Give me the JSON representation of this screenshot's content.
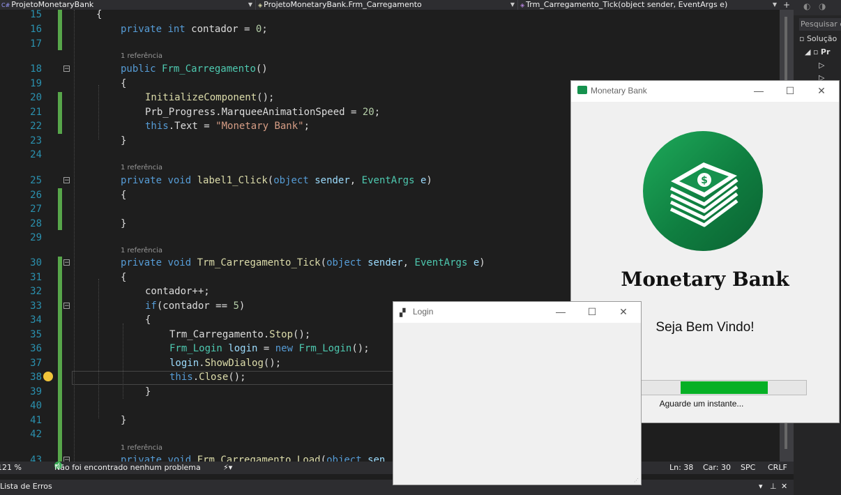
{
  "nav": {
    "project": "ProjetoMonetaryBank",
    "class": "ProjetoMonetaryBank.Frm_Carregamento",
    "member": "Trm_Carregamento_Tick(object sender, EventArgs e)"
  },
  "code": {
    "ref": "1 referência",
    "line_numbers": [
      "15",
      "16",
      "17",
      "18",
      "19",
      "20",
      "21",
      "22",
      "23",
      "24",
      "25",
      "26",
      "27",
      "28",
      "29",
      "30",
      "31",
      "32",
      "33",
      "34",
      "35",
      "36",
      "37",
      "38",
      "39",
      "40",
      "41",
      "42",
      "43"
    ]
  },
  "status": {
    "zoom": "121 %",
    "problems": "Não foi encontrado nenhum problema",
    "line": "Ln: 38",
    "col": "Car: 30",
    "spc": "SPC",
    "crlf": "CRLF"
  },
  "panel": {
    "title": "Lista de Erros"
  },
  "solution_explorer": {
    "search": "Pesquisar e",
    "solution": "Solução",
    "project": "Pr"
  },
  "monetary_window": {
    "title": "Monetary Bank",
    "brand": "Monetary Bank",
    "welcome": "Seja Bem Vindo!",
    "wait": "Aguarde um instante...",
    "progress_start": 0.25,
    "progress_end": 0.77
  },
  "login_window": {
    "title": "Login"
  },
  "colors": {
    "progress": "#06b025",
    "logo": "#16924e",
    "vs_green": "#57a64a"
  }
}
